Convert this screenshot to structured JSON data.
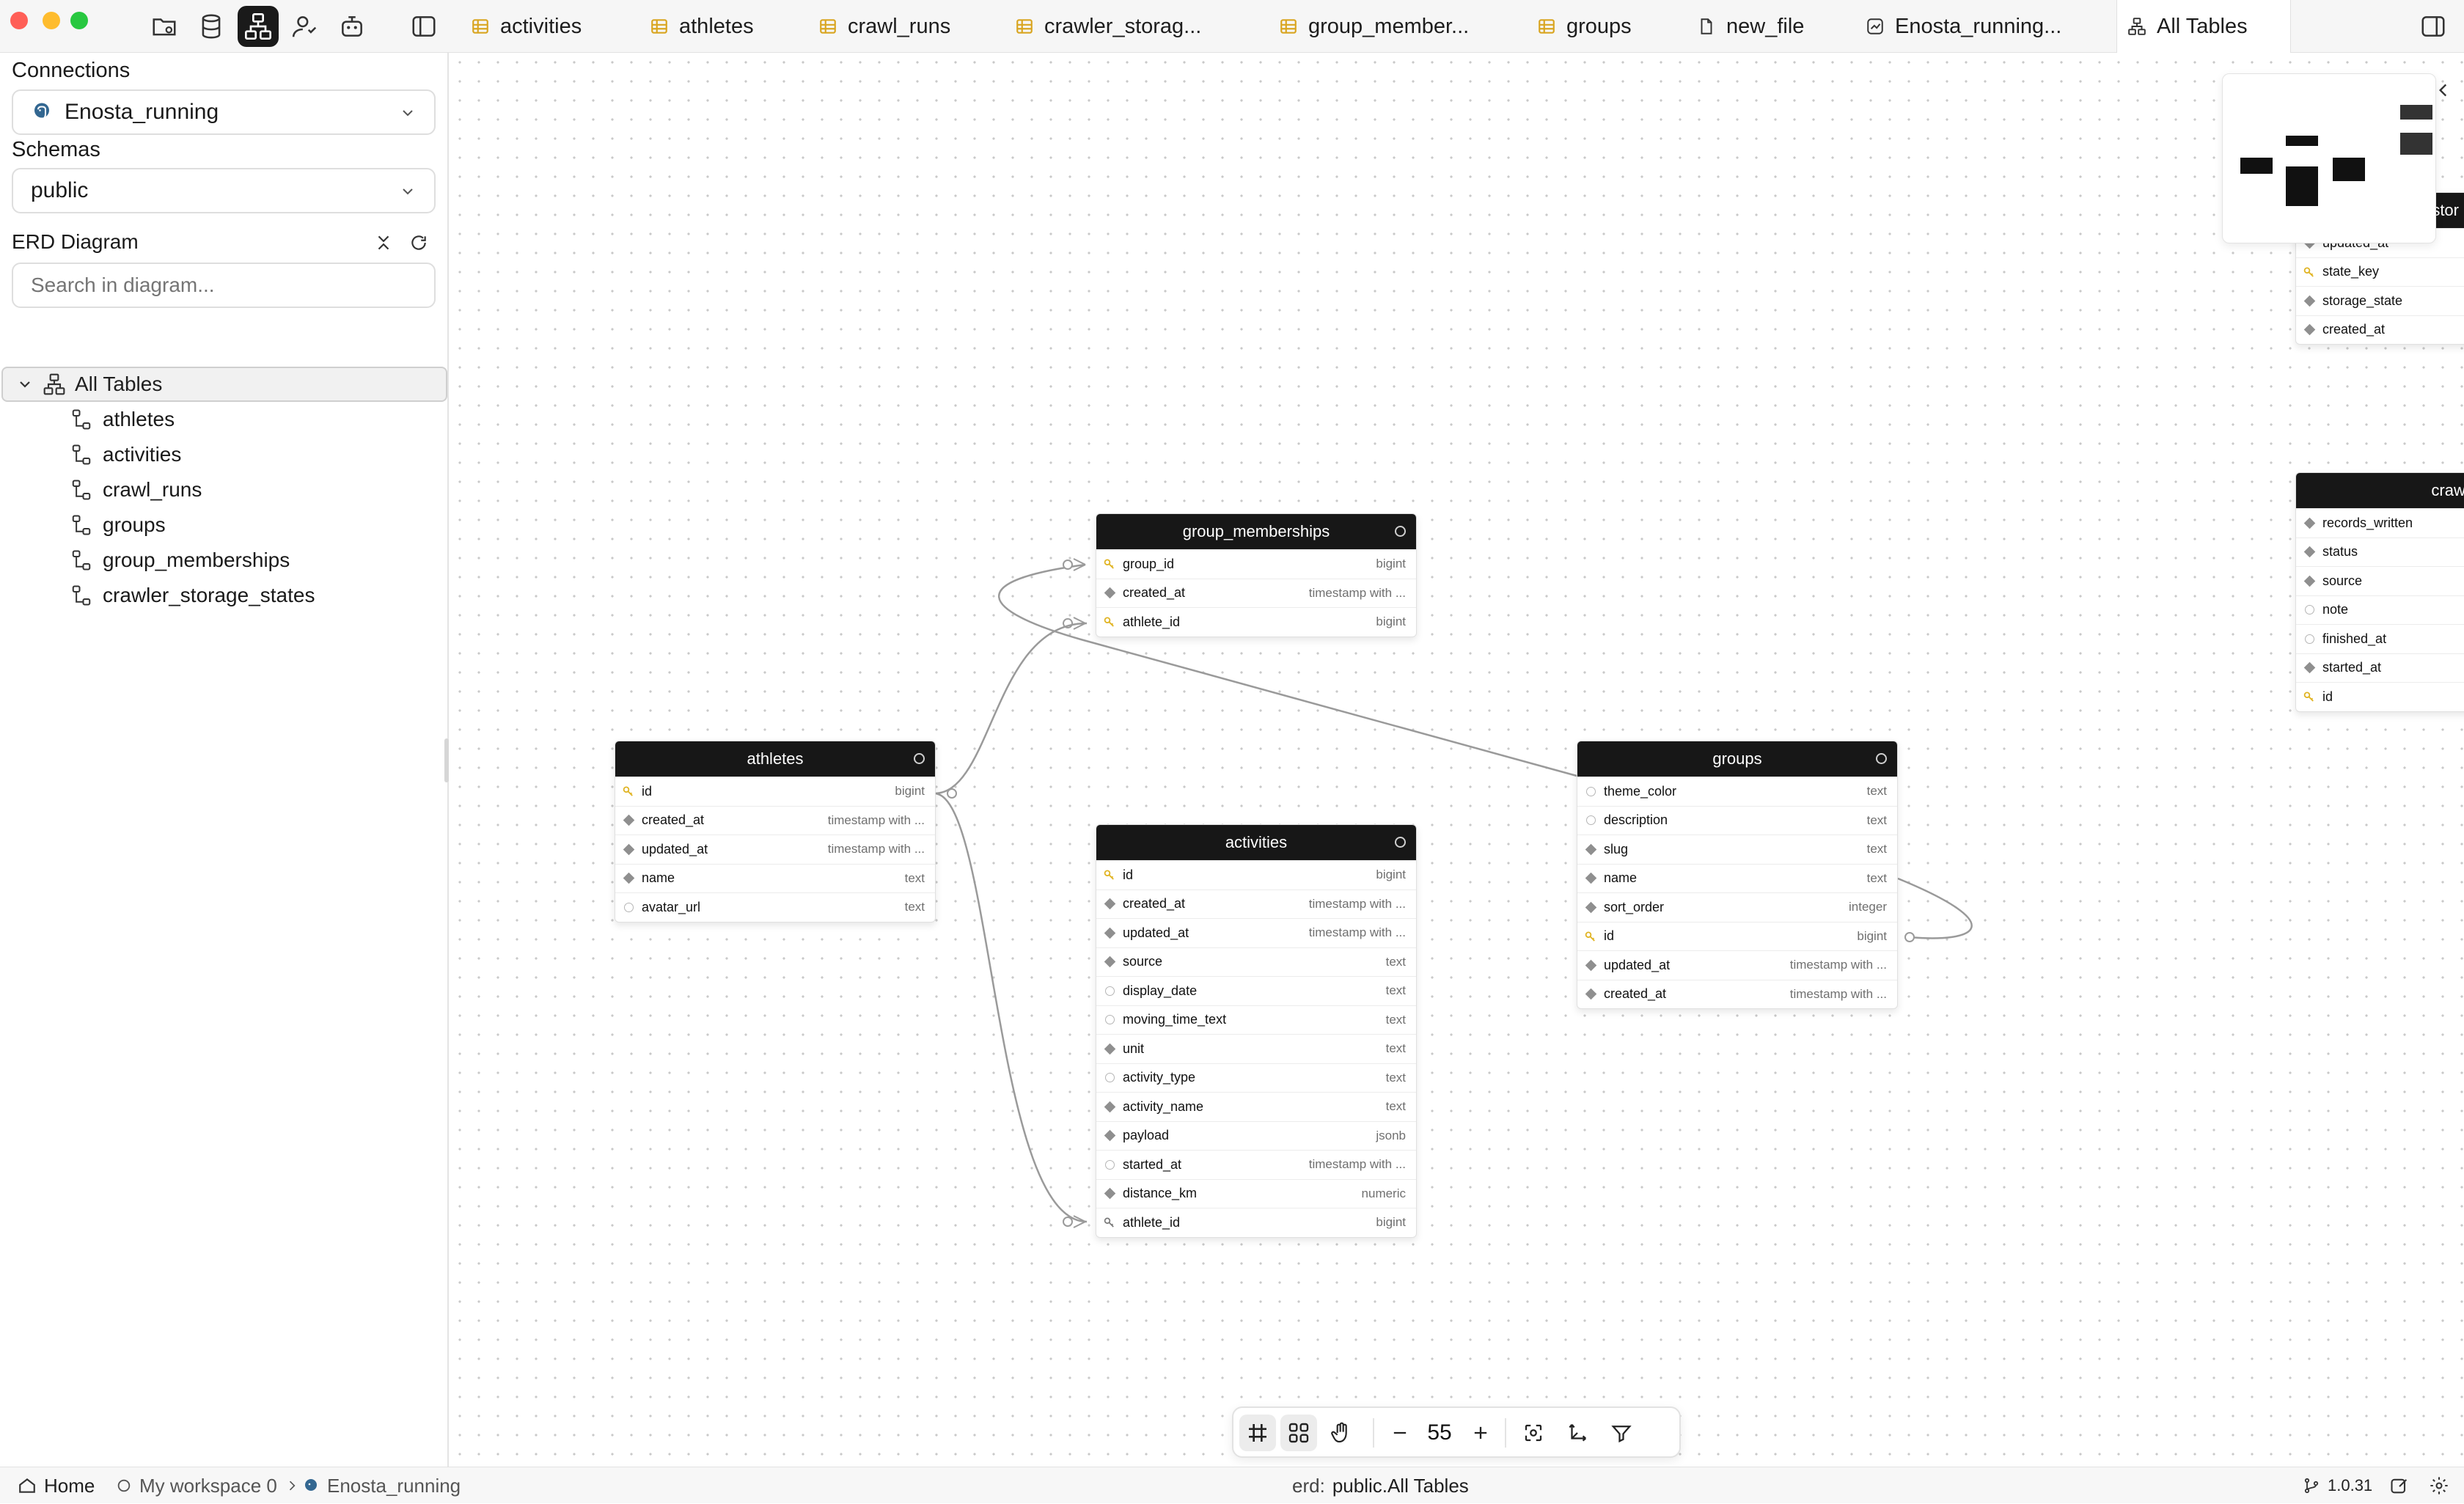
{
  "tabs": [
    {
      "label": "activities",
      "icon": "table-icon"
    },
    {
      "label": "athletes",
      "icon": "table-icon"
    },
    {
      "label": "crawl_runs",
      "icon": "table-icon"
    },
    {
      "label": "crawler_storag...",
      "icon": "table-icon"
    },
    {
      "label": "group_member...",
      "icon": "table-icon"
    },
    {
      "label": "groups",
      "icon": "table-icon"
    },
    {
      "label": "new_file",
      "icon": "file-icon"
    },
    {
      "label": "Enosta_running...",
      "icon": "chart-icon"
    },
    {
      "label": "All Tables",
      "icon": "diagram-icon",
      "active": true
    }
  ],
  "sidebar": {
    "connections_label": "Connections",
    "connection_value": "Enosta_running",
    "schemas_label": "Schemas",
    "schema_value": "public",
    "erd_label": "ERD Diagram",
    "search_placeholder": "Search in diagram...",
    "tree_root": "All Tables",
    "tree_items": [
      "athletes",
      "activities",
      "crawl_runs",
      "groups",
      "group_memberships",
      "crawler_storage_states"
    ]
  },
  "tables": {
    "group_memberships": {
      "title": "group_memberships",
      "rows": [
        {
          "name": "group_id",
          "type": "bigint",
          "kind": "pk"
        },
        {
          "name": "created_at",
          "type": "timestamp with ...",
          "kind": "filled"
        },
        {
          "name": "athlete_id",
          "type": "bigint",
          "kind": "pk"
        }
      ]
    },
    "athletes": {
      "title": "athletes",
      "rows": [
        {
          "name": "id",
          "type": "bigint",
          "kind": "pk"
        },
        {
          "name": "created_at",
          "type": "timestamp with ...",
          "kind": "filled"
        },
        {
          "name": "updated_at",
          "type": "timestamp with ...",
          "kind": "filled"
        },
        {
          "name": "name",
          "type": "text",
          "kind": "filled"
        },
        {
          "name": "avatar_url",
          "type": "text",
          "kind": "empty"
        }
      ]
    },
    "activities": {
      "title": "activities",
      "rows": [
        {
          "name": "id",
          "type": "bigint",
          "kind": "pk"
        },
        {
          "name": "created_at",
          "type": "timestamp with ...",
          "kind": "filled"
        },
        {
          "name": "updated_at",
          "type": "timestamp with ...",
          "kind": "filled"
        },
        {
          "name": "source",
          "type": "text",
          "kind": "filled"
        },
        {
          "name": "display_date",
          "type": "text",
          "kind": "empty"
        },
        {
          "name": "moving_time_text",
          "type": "text",
          "kind": "empty"
        },
        {
          "name": "unit",
          "type": "text",
          "kind": "filled"
        },
        {
          "name": "activity_type",
          "type": "text",
          "kind": "empty"
        },
        {
          "name": "activity_name",
          "type": "text",
          "kind": "filled"
        },
        {
          "name": "payload",
          "type": "jsonb",
          "kind": "filled"
        },
        {
          "name": "started_at",
          "type": "timestamp with ...",
          "kind": "empty"
        },
        {
          "name": "distance_km",
          "type": "numeric",
          "kind": "filled"
        },
        {
          "name": "athlete_id",
          "type": "bigint",
          "kind": "fk"
        }
      ]
    },
    "groups": {
      "title": "groups",
      "rows": [
        {
          "name": "theme_color",
          "type": "text",
          "kind": "empty"
        },
        {
          "name": "description",
          "type": "text",
          "kind": "empty"
        },
        {
          "name": "slug",
          "type": "text",
          "kind": "filled"
        },
        {
          "name": "name",
          "type": "text",
          "kind": "filled"
        },
        {
          "name": "sort_order",
          "type": "integer",
          "kind": "filled"
        },
        {
          "name": "id",
          "type": "bigint",
          "kind": "pk"
        },
        {
          "name": "updated_at",
          "type": "timestamp with ...",
          "kind": "filled"
        },
        {
          "name": "created_at",
          "type": "timestamp with ...",
          "kind": "filled"
        }
      ]
    },
    "crawler_partial": {
      "title": "stor",
      "rows": [
        {
          "name": "updated_at",
          "kind": "filled"
        },
        {
          "name": "state_key",
          "kind": "pk"
        },
        {
          "name": "storage_state",
          "kind": "filled"
        },
        {
          "name": "created_at",
          "kind": "filled"
        }
      ]
    },
    "crawl_partial": {
      "title": "crawl_",
      "rows": [
        {
          "name": "records_written",
          "kind": "filled"
        },
        {
          "name": "status",
          "kind": "filled"
        },
        {
          "name": "source",
          "kind": "filled"
        },
        {
          "name": "note",
          "kind": "empty"
        },
        {
          "name": "finished_at",
          "kind": "empty"
        },
        {
          "name": "started_at",
          "kind": "filled"
        },
        {
          "name": "id",
          "kind": "pk"
        }
      ]
    }
  },
  "toolbar": {
    "zoom": "55"
  },
  "statusbar": {
    "home": "Home",
    "workspace": "My workspace 0",
    "connection": "Enosta_running",
    "erd_prefix": "erd:",
    "erd_value": "public.All Tables",
    "version": "1.0.31"
  },
  "colors": {
    "header_bg": "#171717",
    "accent_active": "#1a1a1a",
    "key_icon": "#e0b321",
    "tab_icon": "#d9a520"
  }
}
